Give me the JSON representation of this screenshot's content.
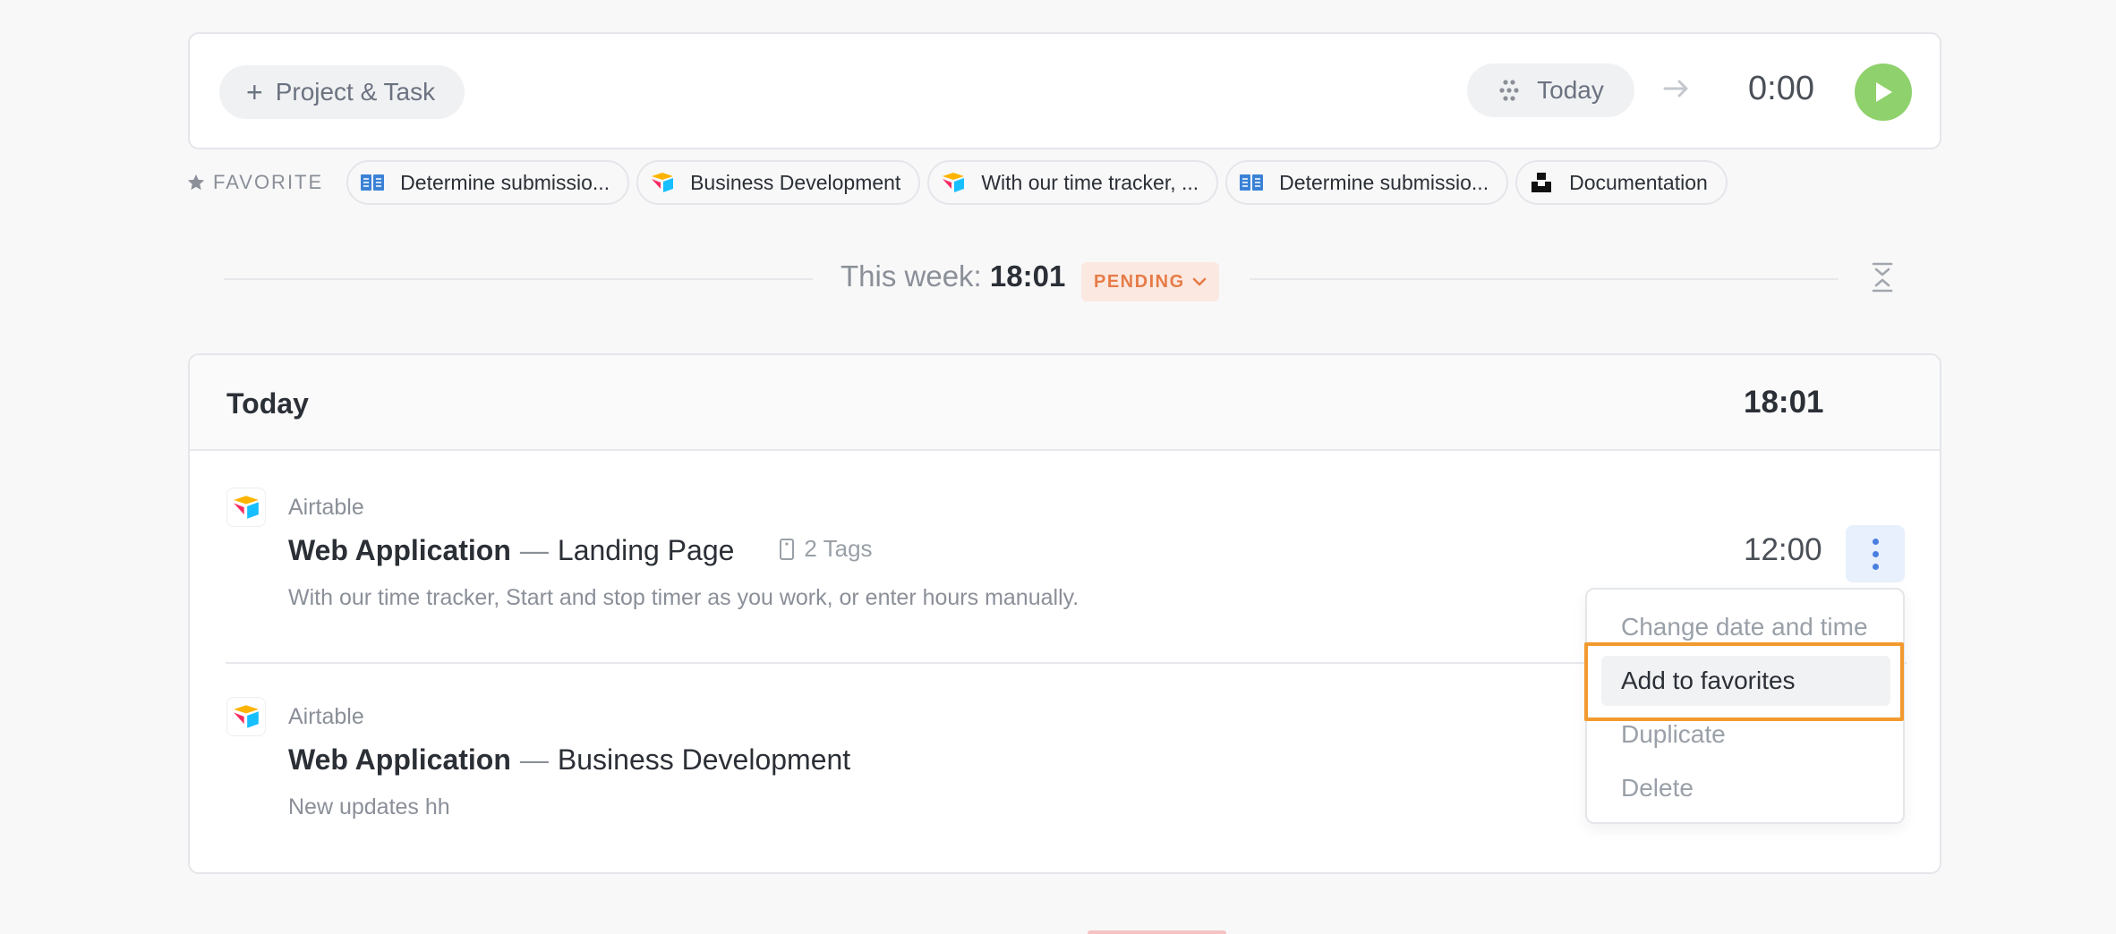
{
  "topbar": {
    "project_task_label": "Project & Task",
    "date_label": "Today",
    "timer_value": "0:00"
  },
  "favorites": {
    "label": "FAVORITE",
    "items": [
      {
        "label": "Determine submissio...",
        "icon": "book-icon"
      },
      {
        "label": "Business Development",
        "icon": "airtable-icon"
      },
      {
        "label": "With our time tracker, ...",
        "icon": "airtable-icon"
      },
      {
        "label": "Determine submissio...",
        "icon": "book-icon"
      },
      {
        "label": "Documentation",
        "icon": "unsplash-icon"
      }
    ]
  },
  "week": {
    "label": "This week:",
    "total": "18:01",
    "status": "PENDING"
  },
  "day": {
    "title": "Today",
    "total": "18:01",
    "entries": [
      {
        "project": "Airtable",
        "title": "Web Application",
        "subtitle": "Landing Page",
        "tags": "2 Tags",
        "description": "With our time tracker, Start and stop timer as you work, or enter hours manually.",
        "time": "12:00"
      },
      {
        "project": "Airtable",
        "title": "Web Application",
        "subtitle": "Business Development",
        "description": "New updates hh"
      }
    ]
  },
  "context_menu": {
    "items": [
      "Change date and time",
      "Add to favorites",
      "Duplicate",
      "Delete"
    ],
    "active_index": 1
  },
  "colors": {
    "play": "#8fd16c",
    "pending_text": "#e67b47",
    "pending_bg": "#fbe9e1",
    "highlight": "#f29a2e",
    "more_button_bg": "#e8f0fd"
  }
}
